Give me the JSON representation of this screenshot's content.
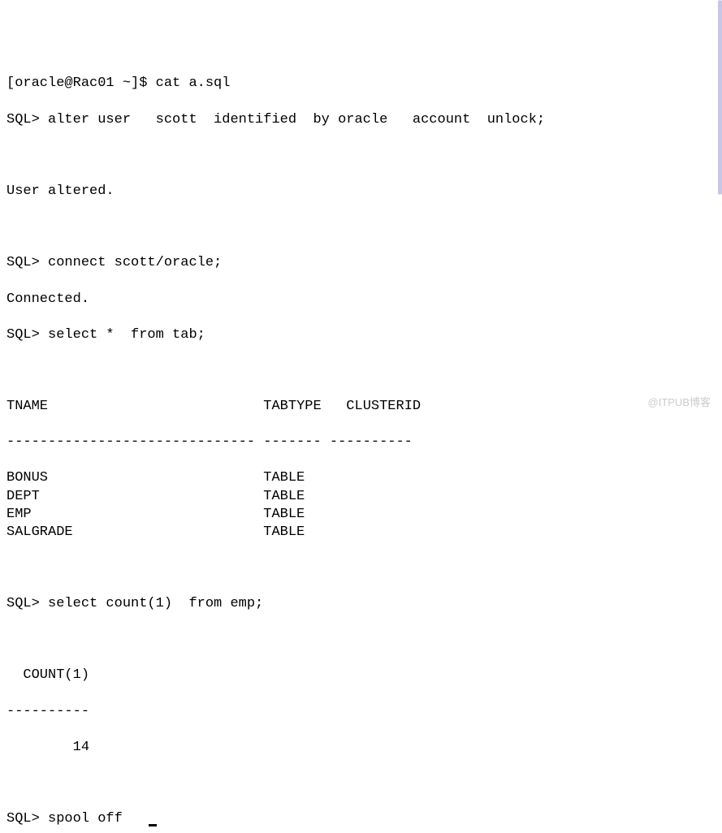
{
  "shell_prompt": "[oracle@Rac01 ~]$ ",
  "shell_command": "cat a.sql",
  "sql_prompt": "SQL> ",
  "statements": {
    "alter_user": "alter user   scott  identified  by oracle   account  unlock;",
    "alter_user_result": "User altered.",
    "connect": "connect scott/oracle;",
    "connect_result": "Connected.",
    "select_tab": "select *  from tab;",
    "select_count": "select count(1)  from emp;",
    "spool_off": "spool off"
  },
  "tab_table": {
    "headers": {
      "tname": "TNAME",
      "tabtype": "TABTYPE",
      "clusterid": "CLUSTERID"
    },
    "separator": "------------------------------ ------- ----------",
    "rows": [
      {
        "tname": "BONUS",
        "tabtype": "TABLE"
      },
      {
        "tname": "DEPT",
        "tabtype": "TABLE"
      },
      {
        "tname": "EMP",
        "tabtype": "TABLE"
      },
      {
        "tname": "SALGRADE",
        "tabtype": "TABLE"
      }
    ]
  },
  "count_table": {
    "header": "  COUNT(1)",
    "separator": "----------",
    "value": "        14"
  },
  "watermark": "@ITPUB博客"
}
